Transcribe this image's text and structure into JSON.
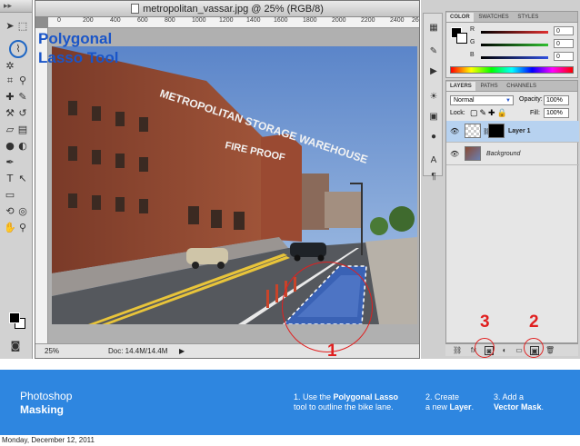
{
  "document": {
    "title": "metropolitan_vassar.jpg @ 25% (RGB/8)",
    "zoom": "25%",
    "doc_size": "Doc: 14.4M/14.4M",
    "ruler_marks": [
      "0",
      "200",
      "400",
      "600",
      "800",
      "1000",
      "1200",
      "1400",
      "1600",
      "1800",
      "2000",
      "2200",
      "2400",
      "26"
    ]
  },
  "callout": {
    "line1": "Polygonal",
    "line2": "Lasso Tool"
  },
  "photo_sign": {
    "line1": "METROPOLITAN STORAGE WAREHOUSE",
    "line2": "FIRE PROOF"
  },
  "color_panel": {
    "tabs": [
      "COLOR",
      "SWATCHES",
      "STYLES"
    ],
    "channels": [
      {
        "label": "R",
        "value": "0",
        "color": "#e03030"
      },
      {
        "label": "G",
        "value": "0",
        "color": "#30c030"
      },
      {
        "label": "B",
        "value": "0",
        "color": "#3050e0"
      }
    ]
  },
  "layers_panel": {
    "tabs": [
      "LAYERS",
      "PATHS",
      "CHANNELS"
    ],
    "blend_mode": "Normal",
    "opacity_label": "Opacity:",
    "opacity": "100%",
    "lock_label": "Lock:",
    "fill_label": "Fill:",
    "fill": "100%",
    "layers": [
      {
        "name": "Layer 1",
        "selected": true
      },
      {
        "name": "Background",
        "selected": false
      }
    ]
  },
  "markers": {
    "one": "1",
    "two": "2",
    "three": "3"
  },
  "banner": {
    "title_line1": "Photoshop",
    "title_line2": "Masking",
    "step1_prefix": "1. Use the ",
    "step1_bold": "Polygonal Lasso",
    "step1_line2": "tool to outline the bike lane.",
    "step2_line1": "2. Create",
    "step2_prefix": "a new ",
    "step2_bold": "Layer",
    "step2_suffix": ".",
    "step3_line1": "3. Add a",
    "step3_bold": "Vector Mask",
    "step3_suffix": "."
  },
  "date": "Monday, December 12, 2011",
  "colors": {
    "banner": "#2e86e0",
    "accent_blue": "#1a55c8",
    "marker_red": "#e02020"
  }
}
